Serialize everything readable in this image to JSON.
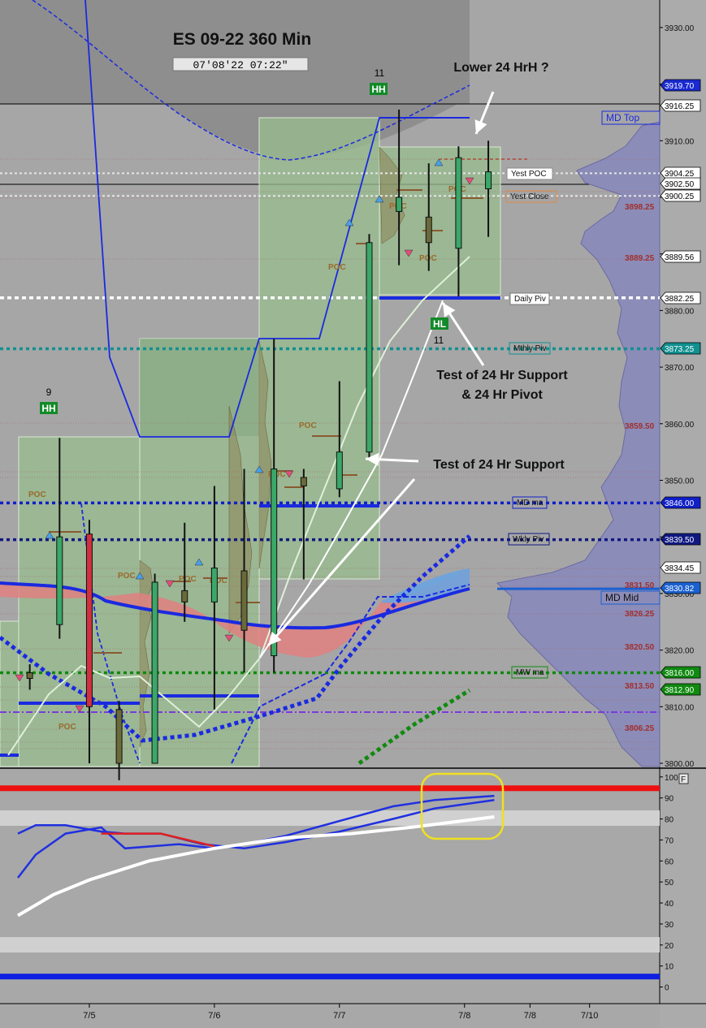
{
  "chart_data": {
    "type": "candlestick",
    "title": "ES  09-22   360 Min",
    "timestamp": "07'08'22   07:22\"",
    "price_axis": {
      "ylim": [
        3800,
        3935
      ],
      "ticks": [
        "3930.00",
        "3920.00",
        "3910.00",
        "3900.00",
        "3890.00",
        "3880.00",
        "3870.00",
        "3860.00",
        "3850.00",
        "3840.00",
        "3830.00",
        "3820.00",
        "3810.00",
        "3800.00"
      ]
    },
    "time_axis": {
      "ticks": [
        {
          "label": "7/5",
          "slot": 12
        },
        {
          "label": "7/6",
          "slot": 33
        },
        {
          "label": "7/7",
          "slot": 54
        },
        {
          "label": "7/8",
          "slot": 75
        },
        {
          "label": "7/8",
          "slot": 86
        },
        {
          "label": "7/10",
          "slot": 96
        }
      ]
    },
    "candles": [
      {
        "slot": 2,
        "o": 3816.0,
        "h": 3817.5,
        "l": 3813.0,
        "c": 3815.0
      },
      {
        "slot": 7,
        "o": 3824.5,
        "h": 3857.5,
        "l": 3822.0,
        "c": 3840.0
      },
      {
        "slot": 12,
        "o": 3840.5,
        "h": 3843.0,
        "l": 3800.0,
        "c": 3810.0
      },
      {
        "slot": 17,
        "o": 3809.5,
        "h": 3811.0,
        "l": 3797.0,
        "c": 3800.0
      },
      {
        "slot": 23,
        "o": 3800.0,
        "h": 3833.5,
        "l": 3800.0,
        "c": 3832.0
      },
      {
        "slot": 28,
        "o": 3830.5,
        "h": 3842.5,
        "l": 3825.0,
        "c": 3828.5
      },
      {
        "slot": 33,
        "o": 3828.5,
        "h": 3849.0,
        "l": 3809.5,
        "c": 3834.5
      },
      {
        "slot": 38,
        "o": 3834.0,
        "h": 3852.0,
        "l": 3816.0,
        "c": 3823.5
      },
      {
        "slot": 43,
        "o": 3819.0,
        "h": 3875.0,
        "l": 3816.0,
        "c": 3852.0
      },
      {
        "slot": 48,
        "o": 3850.5,
        "h": 3852.0,
        "l": 3832.5,
        "c": 3849.0
      },
      {
        "slot": 54,
        "o": 3848.5,
        "h": 3867.5,
        "l": 3847.0,
        "c": 3855.0
      },
      {
        "slot": 59,
        "o": 3855.0,
        "h": 3893.5,
        "l": 3853.5,
        "c": 3892.0
      },
      {
        "slot": 64,
        "o": 3897.5,
        "h": 3915.5,
        "l": 3888.0,
        "c": 3900.0
      },
      {
        "slot": 69,
        "o": 3896.5,
        "h": 3906.0,
        "l": 3887.0,
        "c": 3892.0
      },
      {
        "slot": 74,
        "o": 3891.0,
        "h": 3909.0,
        "l": 3882.5,
        "c": 3907.0
      },
      {
        "slot": 79,
        "o": 3901.5,
        "h": 3910.0,
        "l": 3893.0,
        "c": 3904.5
      }
    ],
    "swing_labels": [
      {
        "count": "9",
        "tag": "HH"
      },
      {
        "count": "11",
        "tag": "HH"
      },
      {
        "count": "11",
        "tag": "HL"
      }
    ],
    "levels": [
      {
        "name": "MD Top",
        "value": 3916.25,
        "color": "#3b3bd6"
      },
      {
        "name": "Yest POC",
        "value": 3904.25,
        "color": "#dcdcdc"
      },
      {
        "name": "Yest Close",
        "value": 3900.25,
        "color": "#dcdcdc"
      },
      {
        "name": "Daily Piv",
        "value": 3882.25,
        "color": "#ffffff"
      },
      {
        "name": "Mthly Piv",
        "value": 3873.25,
        "color": "#129090"
      },
      {
        "name": "MD ma",
        "value": 3846.0,
        "color": "#1020c8"
      },
      {
        "name": "Wkly Piv",
        "value": 3839.5,
        "color": "#101880"
      },
      {
        "name": "MD Mid",
        "value": 3830.82,
        "color": "#1a60d0"
      },
      {
        "name": "MW ma",
        "value": 3816.0,
        "color": "#108a10"
      }
    ],
    "price_tags": [
      {
        "label": "3919.70",
        "bg": "#1a2ad0",
        "fg": "#ffffff"
      },
      {
        "label": "3916.25",
        "bg": "#ffffff",
        "fg": "#000000"
      },
      {
        "label": "3904.25",
        "bg": "#ffffff",
        "fg": "#000000"
      },
      {
        "label": "3902.50",
        "bg": "#ffffff",
        "fg": "#000000"
      },
      {
        "label": "3900.25",
        "bg": "#ffffff",
        "fg": "#000000"
      },
      {
        "label": "3889.56",
        "bg": "#ffffff",
        "fg": "#000000"
      },
      {
        "label": "3882.25",
        "bg": "#ffffff",
        "fg": "#000000"
      },
      {
        "label": "3873.25",
        "bg": "#129090",
        "fg": "#ffffff"
      },
      {
        "label": "3846.00",
        "bg": "#1020c8",
        "fg": "#ffffff"
      },
      {
        "label": "3839.50",
        "bg": "#101880",
        "fg": "#ffffff"
      },
      {
        "label": "3834.45",
        "bg": "#ffffff",
        "fg": "#000000"
      },
      {
        "label": "3830.82",
        "bg": "#1a60d0",
        "fg": "#ffffff"
      },
      {
        "label": "3816.00",
        "bg": "#108a10",
        "fg": "#ffffff"
      },
      {
        "label": "3812.90",
        "bg": "#108a10",
        "fg": "#ffffff"
      }
    ],
    "profile_levels": [
      "3898.25",
      "3889.25",
      "3859.50",
      "3820.50",
      "3813.50",
      "3806.25",
      "3831.50",
      "3826.25"
    ],
    "poc_label": "POC",
    "annotations": [
      {
        "text": "Lower 24 HrH ?"
      },
      {
        "text": "Test of 24 Hr Support\n& 24 Hr Pivot"
      },
      {
        "text": "Test of 24 Hr Support"
      }
    ],
    "oscillator": {
      "ylim": [
        -5,
        105
      ],
      "ticks": [
        "100",
        "90",
        "80",
        "70",
        "60",
        "50",
        "40",
        "30",
        "20",
        "10",
        "0"
      ],
      "corner_label": "F",
      "upper_line": 95,
      "lower_line": 5,
      "series": [
        {
          "color": "#2030e0",
          "values": [
            {
              "slot": 0,
              "v": 52
            },
            {
              "slot": 3,
              "v": 63
            },
            {
              "slot": 8,
              "v": 73
            },
            {
              "slot": 14,
              "v": 76
            },
            {
              "slot": 18,
              "v": 66
            },
            {
              "slot": 27,
              "v": 68
            },
            {
              "slot": 33,
              "v": 66
            },
            {
              "slot": 38,
              "v": 68
            },
            {
              "slot": 45,
              "v": 72
            },
            {
              "slot": 54,
              "v": 79
            },
            {
              "slot": 63,
              "v": 86
            },
            {
              "slot": 70,
              "v": 89
            },
            {
              "slot": 80,
              "v": 91
            }
          ]
        },
        {
          "color": "#2030e0",
          "values": [
            {
              "slot": 0,
              "v": 73
            },
            {
              "slot": 3,
              "v": 77
            },
            {
              "slot": 8,
              "v": 77
            },
            {
              "slot": 14,
              "v": 74
            },
            {
              "slot": 18,
              "v": 73
            },
            {
              "slot": 24,
              "v": 73
            },
            {
              "slot": 31,
              "v": 68
            },
            {
              "slot": 38,
              "v": 66
            },
            {
              "slot": 45,
              "v": 69
            },
            {
              "slot": 54,
              "v": 74
            },
            {
              "slot": 63,
              "v": 80
            },
            {
              "slot": 70,
              "v": 85
            },
            {
              "slot": 80,
              "v": 89
            }
          ]
        },
        {
          "color": "#e02020",
          "values": [
            {
              "slot": 14,
              "v": 73
            },
            {
              "slot": 24,
              "v": 73
            },
            {
              "slot": 33,
              "v": 67
            }
          ]
        },
        {
          "color": "#ffffff",
          "values": [
            {
              "slot": 0,
              "v": 34
            },
            {
              "slot": 6,
              "v": 44
            },
            {
              "slot": 12,
              "v": 51
            },
            {
              "slot": 22,
              "v": 60
            },
            {
              "slot": 33,
              "v": 66
            },
            {
              "slot": 45,
              "v": 71
            },
            {
              "slot": 56,
              "v": 73
            },
            {
              "slot": 66,
              "v": 76
            },
            {
              "slot": 80,
              "v": 81
            }
          ]
        }
      ]
    }
  }
}
